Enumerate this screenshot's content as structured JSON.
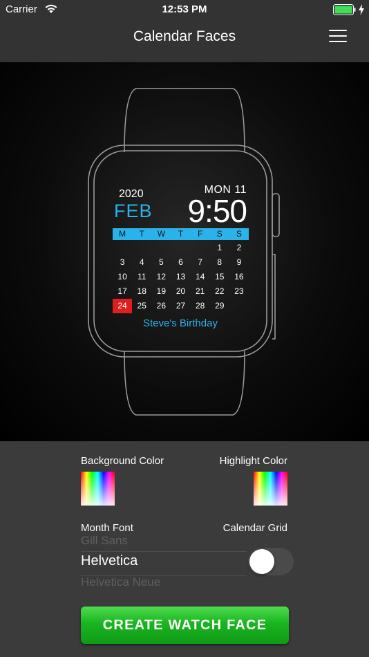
{
  "status_bar": {
    "carrier": "Carrier",
    "time": "12:53 PM"
  },
  "nav": {
    "title": "Calendar Faces",
    "menu_icon": "hamburger-menu-icon"
  },
  "watch": {
    "year": "2020",
    "month": "FEB",
    "day_label": "MON 11",
    "time": "9:50",
    "weekdays": [
      "M",
      "T",
      "W",
      "T",
      "F",
      "S",
      "S"
    ],
    "weeks": [
      [
        "",
        "",
        "",
        "",
        "",
        "1",
        "2"
      ],
      [
        "3",
        "4",
        "5",
        "6",
        "7",
        "8",
        "9"
      ],
      [
        "10",
        "11",
        "12",
        "13",
        "14",
        "15",
        "16"
      ],
      [
        "17",
        "18",
        "19",
        "20",
        "21",
        "22",
        "23"
      ],
      [
        "24",
        "25",
        "26",
        "27",
        "28",
        "29",
        ""
      ]
    ],
    "highlighted_day": "24",
    "event": "Steve's Birthday",
    "accent_color": "#29b3ea",
    "highlight_color": "#e01e1e"
  },
  "settings": {
    "background_color_label": "Background Color",
    "highlight_color_label": "Highlight Color",
    "month_font_label": "Month Font",
    "calendar_grid_label": "Calendar Grid",
    "font_options": {
      "previous": "Gill Sans",
      "selected": "Helvetica",
      "next": "Helvetica Neue"
    },
    "calendar_grid_on": false,
    "create_button": "CREATE WATCH FACE",
    "button_color": "#19b51f"
  }
}
